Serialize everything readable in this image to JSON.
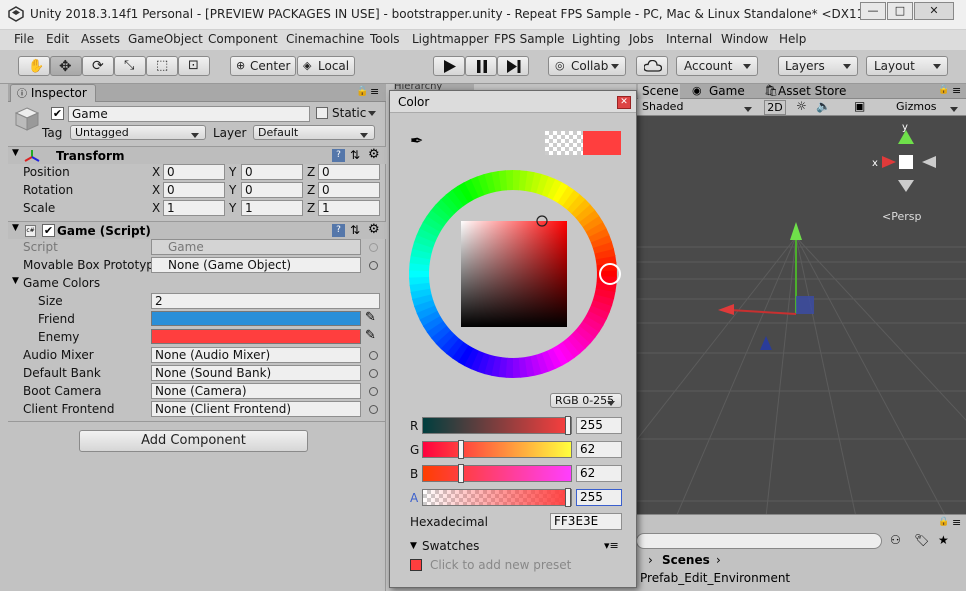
{
  "window": {
    "title": "Unity 2018.3.14f1 Personal - [PREVIEW PACKAGES IN USE] - bootstrapper.unity - Repeat FPS Sample - PC, Mac & Linux Standalone* <DX11>",
    "controls": [
      "—",
      "□",
      "✕"
    ]
  },
  "menu": [
    "File",
    "Edit",
    "Assets",
    "GameObject",
    "Component",
    "Cinemachine",
    "Tools",
    "Lightmapper",
    "FPS Sample",
    "Lighting",
    "Jobs",
    "Internal",
    "Window",
    "Help"
  ],
  "toolbar": {
    "center": "Center",
    "local": "Local",
    "collab": "Collab",
    "account": "Account",
    "layers": "Layers",
    "layout": "Layout"
  },
  "inspector": {
    "tab": "Inspector",
    "object_name": "Game",
    "static_label": "Static",
    "tag_label": "Tag",
    "tag_value": "Untagged",
    "layer_label": "Layer",
    "layer_value": "Default",
    "transform": {
      "title": "Transform",
      "rows": [
        {
          "label": "Position",
          "x": "0",
          "y": "0",
          "z": "0"
        },
        {
          "label": "Rotation",
          "x": "0",
          "y": "0",
          "z": "0"
        },
        {
          "label": "Scale",
          "x": "1",
          "y": "1",
          "z": "1"
        }
      ],
      "axis": [
        "X",
        "Y",
        "Z"
      ]
    },
    "script": {
      "title": "Game (Script)",
      "script_label": "Script",
      "script_value": "Game",
      "movable_label": "Movable Box Prototyp",
      "movable_value": "None (Game Object)",
      "game_colors": "Game Colors",
      "size_label": "Size",
      "size_value": "2",
      "friend_label": "Friend",
      "friend_color": "#2a8fd8",
      "enemy_label": "Enemy",
      "enemy_color": "#ff3e3e",
      "refs": [
        {
          "label": "Audio Mixer",
          "value": "None (Audio Mixer)"
        },
        {
          "label": "Default Bank",
          "value": "None (Sound Bank)"
        },
        {
          "label": "Boot Camera",
          "value": "None (Camera)"
        },
        {
          "label": "Client Frontend",
          "value": "None (Client Frontend)"
        }
      ]
    },
    "add_component": "Add Component"
  },
  "scene": {
    "tabs": [
      "Scene",
      "Game",
      "Asset Store"
    ],
    "shaded": "Shaded",
    "mode_2d": "2D",
    "gizmos": "Gizmos",
    "persp": "Persp",
    "axis_y": "y",
    "axis_x": "x"
  },
  "bottom_panel": {
    "breadcrumb": "Scenes",
    "item": "Prefab_Edit_Environment"
  },
  "color_window": {
    "title": "Color",
    "mode": "RGB 0-255",
    "channels": [
      {
        "label": "R",
        "value": "255",
        "handle_fraction": 1.0
      },
      {
        "label": "G",
        "value": "62",
        "handle_fraction": 0.243
      },
      {
        "label": "B",
        "value": "62",
        "handle_fraction": 0.243
      },
      {
        "label": "A",
        "value": "255",
        "handle_fraction": 1.0
      }
    ],
    "hex_label": "Hexadecimal",
    "hex_value": "FF3E3E",
    "swatches_label": "Swatches",
    "add_preset": "Click to add new preset",
    "current_color": "#ff3e3e"
  },
  "hierarchy_tab_partial": "Hierarchy"
}
